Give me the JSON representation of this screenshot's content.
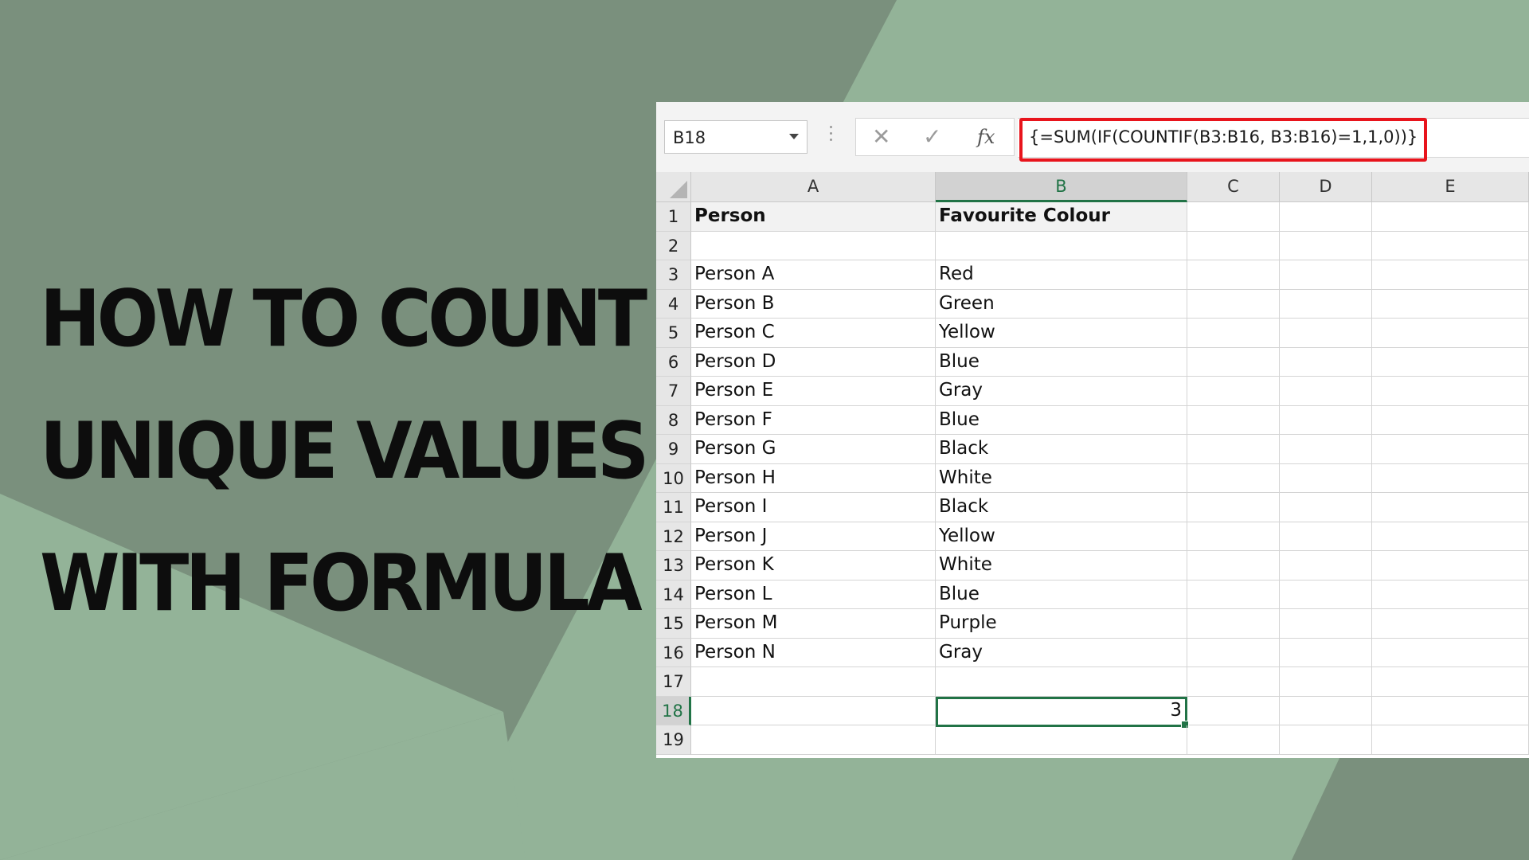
{
  "headline": {
    "lines": [
      "HOW TO COUNT",
      "UNIQUE VALUES",
      "WITH FORMULA"
    ]
  },
  "colors": {
    "bg_light": "#93b398",
    "bg_dark": "#7a907d",
    "accent_red": "#e8141c",
    "excel_green": "#217346"
  },
  "excel": {
    "name_box": "B18",
    "formula": "{=SUM(IF(COUNTIF(B3:B16, B3:B16)=1,1,0))}",
    "icons": {
      "cancel": "x-icon",
      "enter": "check-icon",
      "function": "fx-icon"
    },
    "columns": [
      "A",
      "B",
      "C",
      "D",
      "E"
    ],
    "selected_column": "B",
    "selected_row": 18,
    "rows": [
      {
        "n": "1",
        "a": "Person",
        "b": "Favourite Colour"
      },
      {
        "n": "2",
        "a": "",
        "b": ""
      },
      {
        "n": "3",
        "a": "Person A",
        "b": "Red"
      },
      {
        "n": "4",
        "a": "Person B",
        "b": "Green"
      },
      {
        "n": "5",
        "a": "Person C",
        "b": "Yellow"
      },
      {
        "n": "6",
        "a": "Person D",
        "b": "Blue"
      },
      {
        "n": "7",
        "a": "Person E",
        "b": "Gray"
      },
      {
        "n": "8",
        "a": "Person F",
        "b": "Blue"
      },
      {
        "n": "9",
        "a": "Person G",
        "b": "Black"
      },
      {
        "n": "10",
        "a": "Person H",
        "b": "White"
      },
      {
        "n": "11",
        "a": "Person I",
        "b": "Black"
      },
      {
        "n": "12",
        "a": "Person J",
        "b": "Yellow"
      },
      {
        "n": "13",
        "a": "Person K",
        "b": "White"
      },
      {
        "n": "14",
        "a": "Person L",
        "b": "Blue"
      },
      {
        "n": "15",
        "a": "Person M",
        "b": "Purple"
      },
      {
        "n": "16",
        "a": "Person N",
        "b": "Gray"
      },
      {
        "n": "17",
        "a": "",
        "b": ""
      },
      {
        "n": "18",
        "a": "",
        "b": "3"
      },
      {
        "n": "19",
        "a": "",
        "b": ""
      }
    ]
  }
}
